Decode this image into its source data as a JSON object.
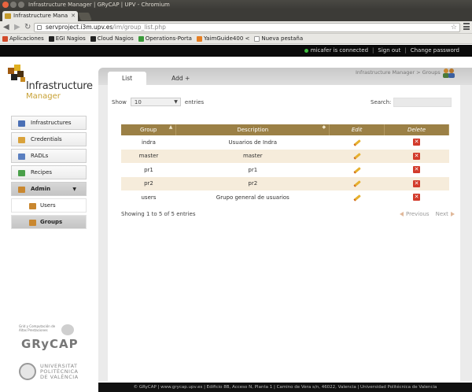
{
  "window": {
    "title": "Infrastructure Manager | GRyCAP | UPV - Chromium"
  },
  "browser": {
    "tab_title": "Infrastructure Mana",
    "url_host": "servproject.i3m.upv.es",
    "url_path": "/im/group_list.php",
    "bookmarks": [
      {
        "label": "Aplicaciones",
        "color": "#d24a2a"
      },
      {
        "label": "EGI Nagios",
        "color": "#222222"
      },
      {
        "label": "Cloud Nagios",
        "color": "#222222"
      },
      {
        "label": "Operations-Porta",
        "color": "#3a9a3a"
      },
      {
        "label": "YaimGuide400 <",
        "color": "#e67e22"
      },
      {
        "label": "Nueva pestaña",
        "color": "#ffffff"
      }
    ]
  },
  "header": {
    "status": "micafer is connected",
    "sign_out": "Sign out",
    "change_password": "Change password"
  },
  "logo": {
    "line1": "Infrastructure",
    "line2": "Manager"
  },
  "sidebar": {
    "items": [
      {
        "label": "Infrastructures",
        "color": "#4a6fb5"
      },
      {
        "label": "Credentials",
        "color": "#d9a23b"
      },
      {
        "label": "RADLs",
        "color": "#5a7fc0"
      },
      {
        "label": "Recipes",
        "color": "#4aa04a"
      },
      {
        "label": "Admin",
        "color": "#c9872f"
      },
      {
        "label": "Users",
        "color": "#c9872f"
      },
      {
        "label": "Groups",
        "color": "#c9872f"
      }
    ],
    "admin_caret": "▼"
  },
  "content": {
    "tabs": [
      "List",
      "Add +"
    ],
    "breadcrumb": "Infrastructure Manager > Groups"
  },
  "table": {
    "show_label": "Show",
    "page_len": "10",
    "entries_label": "entries",
    "search_label": "Search:",
    "columns": [
      "Group",
      "Description",
      "Edit",
      "Delete"
    ],
    "rows": [
      {
        "group": "indra",
        "description": "Usuarios de Indra"
      },
      {
        "group": "master",
        "description": "master"
      },
      {
        "group": "pr1",
        "description": "pr1"
      },
      {
        "group": "pr2",
        "description": "pr2"
      },
      {
        "group": "users",
        "description": "Grupo general de usuarios"
      }
    ],
    "info": "Showing 1 to 5 of 5 entries",
    "prev": "Previous",
    "next": "Next"
  },
  "branding": {
    "grycap_small": "Grid y Computación de Altas Prestaciones",
    "grycap": "GRyCAP",
    "upv1": "UNIVERSITAT",
    "upv2": "POLITÈCNICA",
    "upv3": "DE VALÈNCIA"
  },
  "footer": "© GRyCAP | www.grycap.upv.es | Edificio 8B, Acceso N, Planta 1 | Camino de Vera s/n, 46022, Valencia | Universidad Politécnica de Valencia"
}
